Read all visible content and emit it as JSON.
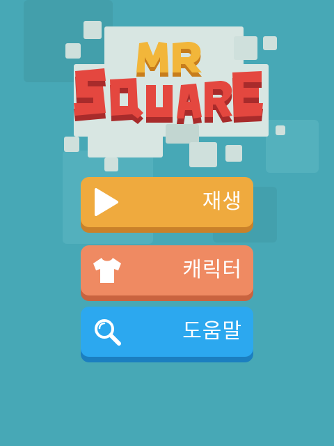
{
  "title": {
    "line1": "MR",
    "line2": "SQUARE"
  },
  "menu": {
    "play_label": "재생",
    "character_label": "캐릭터",
    "help_label": "도움말"
  },
  "icons": {
    "play": "play-icon",
    "character": "t-shirt-icon",
    "help": "magnifier-icon"
  },
  "colors": {
    "background": "#47a8b6",
    "play_button": "#efaa3e",
    "character_button": "#ef8a62",
    "help_button": "#2ca8ef",
    "title_red": "#e4473f",
    "title_yellow": "#f2b63a"
  }
}
